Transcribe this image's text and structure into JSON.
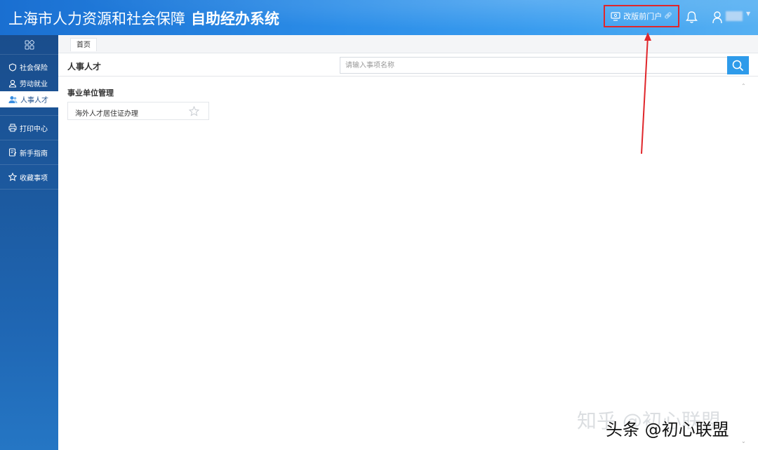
{
  "header": {
    "title": "上海市人力资源和社会保障",
    "title_strong": "自助经办系统",
    "portal_button": "改版前门户",
    "colors": {
      "accent": "#2b8de8",
      "annotation": "#e0262b"
    }
  },
  "sidebar": {
    "top_icon": "apps-icon",
    "items": [
      {
        "label": "社会保险",
        "icon": "shield-icon"
      },
      {
        "label": "劳动就业",
        "icon": "worker-icon"
      },
      {
        "label": "人事人才",
        "icon": "people-icon"
      }
    ],
    "blocks": [
      {
        "label": "打印中心",
        "icon": "printer-icon"
      },
      {
        "label": "新手指南",
        "icon": "guide-icon"
      },
      {
        "label": "收藏事项",
        "icon": "star-icon"
      }
    ]
  },
  "main": {
    "breadcrumb": "首页",
    "title": "人事人才",
    "search": {
      "placeholder": "请输入事项名称",
      "value": ""
    },
    "group_title": "事业单位管理",
    "items": [
      {
        "label": "海外人才居住证办理"
      }
    ]
  },
  "watermarks": {
    "zhihu": "知乎 @初心联盟",
    "toutiao": "头条 @初心联盟"
  }
}
